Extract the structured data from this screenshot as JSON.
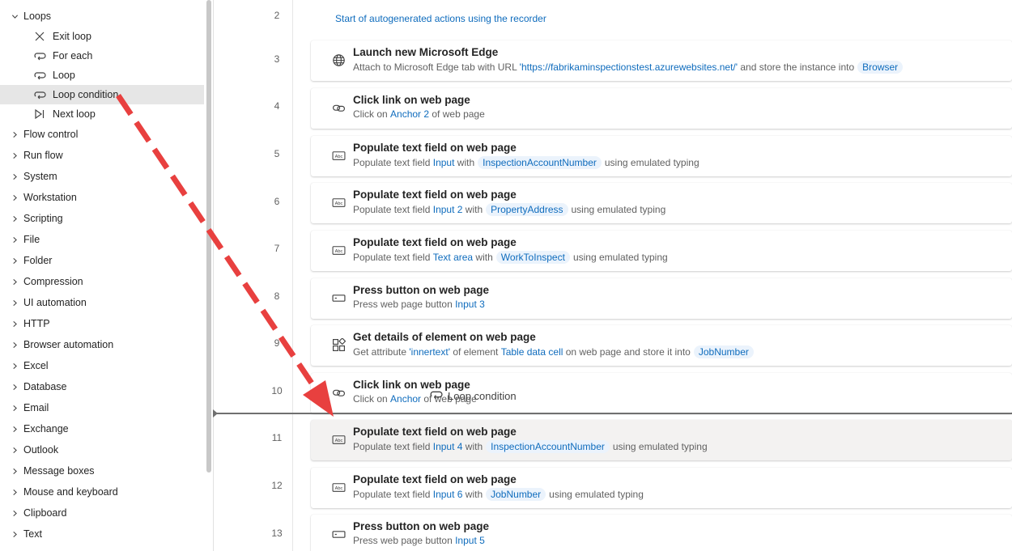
{
  "sidebar": {
    "group": {
      "label": "Loops",
      "icon": "chevron-down-icon"
    },
    "loop_items": [
      {
        "label": "Exit loop",
        "icon": "close-icon"
      },
      {
        "label": "For each",
        "icon": "loop-icon"
      },
      {
        "label": "Loop",
        "icon": "loop-icon"
      },
      {
        "label": "Loop condition",
        "icon": "loop-icon",
        "selected": true
      },
      {
        "label": "Next loop",
        "icon": "next-loop-icon"
      }
    ],
    "categories": [
      "Flow control",
      "Run flow",
      "System",
      "Workstation",
      "Scripting",
      "File",
      "Folder",
      "Compression",
      "UI automation",
      "HTTP",
      "Browser automation",
      "Excel",
      "Database",
      "Email",
      "Exchange",
      "Outlook",
      "Message boxes",
      "Mouse and keyboard",
      "Clipboard",
      "Text"
    ]
  },
  "flow": {
    "comment": {
      "line": "2",
      "text": "Start of autogenerated actions using the recorder"
    },
    "steps": [
      {
        "line": "3",
        "icon": "globe-icon",
        "title": "Launch new Microsoft Edge",
        "d": [
          "Attach to Microsoft Edge tab with URL ",
          "'https://fabrikaminspectionstest.azurewebsites.net/'",
          " and store the instance into",
          "Browser",
          ""
        ]
      },
      {
        "line": "4",
        "icon": "link-icon",
        "title": "Click link on web page",
        "d": [
          "Click on ",
          "Anchor 2",
          " of web page"
        ]
      },
      {
        "line": "5",
        "icon": "textfield-icon",
        "title": "Populate text field on web page",
        "d": [
          "Populate text field ",
          "Input",
          " with",
          "InspectionAccountNumber",
          "using emulated typing"
        ]
      },
      {
        "line": "6",
        "icon": "textfield-icon",
        "title": "Populate text field on web page",
        "d": [
          "Populate text field ",
          "Input 2",
          " with",
          "PropertyAddress",
          "using emulated typing"
        ]
      },
      {
        "line": "7",
        "icon": "textfield-icon",
        "title": "Populate text field on web page",
        "d": [
          "Populate text field ",
          "Text area",
          " with",
          "WorkToInspect",
          "using emulated typing"
        ]
      },
      {
        "line": "8",
        "icon": "button-icon",
        "title": "Press button on web page",
        "d": [
          "Press web page button ",
          "Input 3",
          ""
        ]
      },
      {
        "line": "9",
        "icon": "element-details-icon",
        "title": "Get details of element on web page",
        "d": [
          "Get attribute ",
          "'innertext'",
          " of element ",
          "Table data cell",
          " on web page and store it into",
          "JobNumber"
        ]
      },
      {
        "line": "10",
        "icon": "link-icon",
        "title": "Click link on web page",
        "d": [
          "Click on ",
          "Anchor",
          " of web page"
        ]
      },
      {
        "line": "11",
        "icon": "textfield-icon",
        "title": "Populate text field on web page",
        "d": [
          "Populate text field ",
          "Input 4",
          " with",
          "InspectionAccountNumber",
          "using emulated typing"
        ]
      },
      {
        "line": "12",
        "icon": "textfield-icon",
        "title": "Populate text field on web page",
        "d": [
          "Populate text field ",
          "Input 6",
          " with",
          "JobNumber",
          "using emulated typing"
        ]
      },
      {
        "line": "13",
        "icon": "button-icon",
        "title": "Press button on web page",
        "d": [
          "Press web page button ",
          "Input 5",
          ""
        ]
      }
    ]
  },
  "drag": {
    "ghost_label": "Loop condition",
    "ghost_icon": "loop-icon"
  },
  "annotation": {
    "arrow_color": "#e8403f",
    "arrow_icon": "red-dashed-arrow"
  }
}
